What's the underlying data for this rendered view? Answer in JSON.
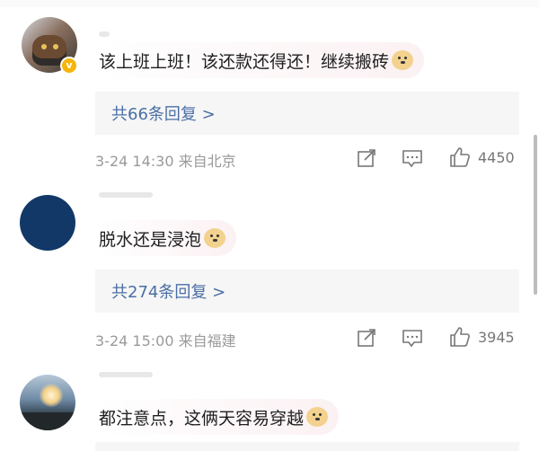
{
  "comments": [
    {
      "text": "该上班上班！该还款还得还！继续搬砖",
      "replies": "共66条回复 >",
      "time": "3-24 14:30",
      "location": "来自北京",
      "likes": "4450"
    },
    {
      "text": "脱水还是浸泡",
      "replies": "共274条回复 >",
      "time": "3-24 15:00",
      "location": "来自福建",
      "likes": "3945"
    },
    {
      "text": "都注意点，这俩天容易穿越"
    }
  ]
}
